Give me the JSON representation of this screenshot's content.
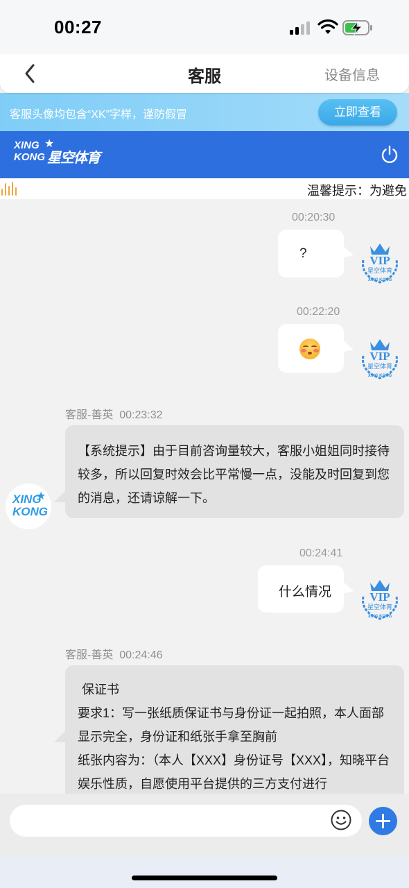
{
  "status_bar": {
    "time": "00:27"
  },
  "nav": {
    "title": "客服",
    "right_label": "设备信息"
  },
  "notice": {
    "text": "客服头像均包含“XK”字样，谨防假冒",
    "button_label": "立即查看"
  },
  "brand": {
    "logo_en_line1": "XING",
    "logo_en_line2": "KONG",
    "logo_cn": "星空体育"
  },
  "marquee": {
    "text": "温馨提示：为避免"
  },
  "messages": [
    {
      "side": "right",
      "time": "00:20:30",
      "text": "?"
    },
    {
      "side": "right",
      "time": "00:22:20",
      "emoji": "pleading-face-emoji"
    },
    {
      "side": "left",
      "sender": "客服-善英",
      "time": "00:23:32",
      "text": "【系统提示】由于目前咨询量较大，客服小姐姐同时接待较多，所以回复时效会比平常慢一点，没能及时回复到您的消息，还请谅解一下。"
    },
    {
      "side": "right",
      "time": "00:24:41",
      "text": "什么情况"
    },
    {
      "side": "left",
      "sender": "客服-善英",
      "time": "00:24:46",
      "lines": [
        "保证书",
        "要求1：写一张纸质保证书与身份证一起拍照，本人面部显示完全，身份证和纸张手拿至胸前",
        "纸张内容为：（本人【XXX】身份证号【XXX】，知晓平台娱乐性质，自愿使用平台提供的三方支付进行"
      ]
    }
  ],
  "avatar": {
    "vip_label": "VIP",
    "vip_cn": "星空体育",
    "vip_en": "XING KONG",
    "agent_line1": "XING",
    "agent_line2": "KONG"
  },
  "input": {
    "placeholder": "",
    "value": ""
  },
  "icons": {
    "back": "back-arrow-icon",
    "power": "power-icon",
    "emoji": "smile-icon",
    "plus": "plus-icon"
  },
  "colors": {
    "brand_blue": "#2d6fdf",
    "notice_blue": "#7fcdf7",
    "plus_blue": "#2f7ae5"
  }
}
